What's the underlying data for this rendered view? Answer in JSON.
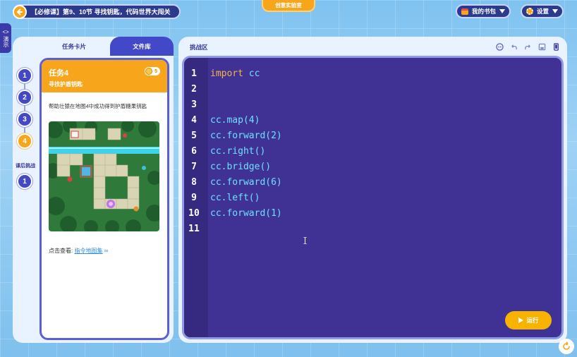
{
  "header": {
    "course_title": "【必修课】第9、10节 寻找钥匙，代码世界大闯关",
    "lab_label": "创意实验室",
    "bag_label": "我的书包",
    "settings_label": "设置",
    "demo_label": "演示",
    "demo_icon_text": "<>"
  },
  "left_panel": {
    "tab_task": "任务卡片",
    "tab_library": "文件库",
    "steps": [
      "1",
      "2",
      "3",
      "4"
    ],
    "homework_label": "课后挑战",
    "homework_steps": [
      "1"
    ],
    "card": {
      "title": "任务4",
      "subtitle": "寻找护盾钥匙",
      "coins": "5",
      "description": "帮助壮猿在地图4中成功得到护盾糖果钥匙",
      "link_prefix": "点击查看:",
      "link_text": "指令地图集"
    }
  },
  "right_panel": {
    "challenge_label": "挑战区",
    "run_label": "运行",
    "code_lines": [
      {
        "num": "1",
        "kw": "import",
        "code": " cc"
      },
      {
        "num": "2",
        "kw": "",
        "code": ""
      },
      {
        "num": "3",
        "kw": "",
        "code": ""
      },
      {
        "num": "4",
        "kw": "",
        "code": "cc.map(4)"
      },
      {
        "num": "5",
        "kw": "",
        "code": "cc.forward(2)"
      },
      {
        "num": "6",
        "kw": "",
        "code": "cc.right()"
      },
      {
        "num": "7",
        "kw": "",
        "code": "cc.bridge()"
      },
      {
        "num": "8",
        "kw": "",
        "code": "cc.forward(6)"
      },
      {
        "num": "9",
        "kw": "",
        "code": "cc.left()"
      },
      {
        "num": "10",
        "kw": "",
        "code": "cc.forward(1)"
      },
      {
        "num": "11",
        "kw": "",
        "code": ""
      }
    ]
  },
  "colors": {
    "accent_orange": "#f7a61c",
    "primary_blue": "#4348c8",
    "editor_bg": "#3f3294",
    "code_cyan": "#6ee0ff",
    "keyword_orange": "#f7b24a"
  }
}
